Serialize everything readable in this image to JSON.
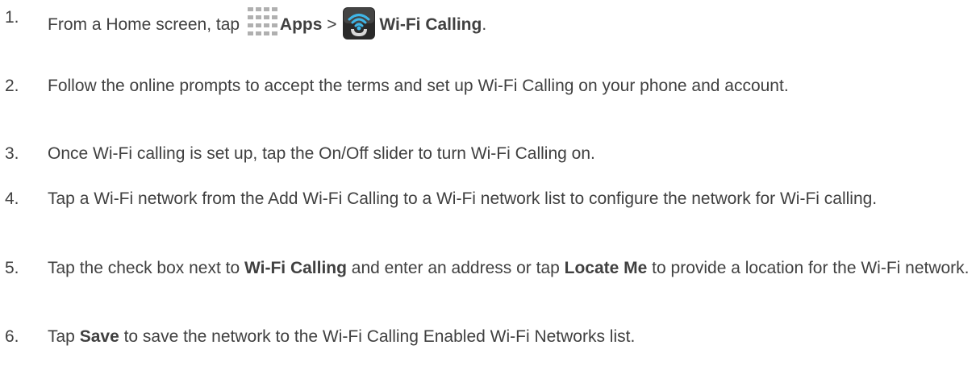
{
  "steps": [
    {
      "number": "1.",
      "pre": "From a Home screen, tap ",
      "apps_label": "Apps",
      "separator": " > ",
      "wifi_label": "Wi-Fi Calling",
      "post": "."
    },
    {
      "number": "2.",
      "text": "Follow the online prompts to accept the terms and  set up Wi-Fi Calling on your phone and account."
    },
    {
      "number": "3.",
      "text": "Once Wi-Fi calling is set up, tap the On/Off slider to turn Wi-Fi Calling on."
    },
    {
      "number": "4.",
      "text": "Tap a Wi-Fi network from the Add Wi-Fi Calling to a Wi-Fi network list to configure the network for Wi-Fi calling."
    },
    {
      "number": "5.",
      "pre": "Tap the check box next to ",
      "bold1": "Wi-Fi Calling",
      "mid": " and enter an address or tap ",
      "bold2": "Locate Me",
      "post": " to provide a location for the Wi-Fi network."
    },
    {
      "number": "6.",
      "pre": "Tap ",
      "bold1": "Save",
      "post": " to save the network to the Wi-Fi Calling Enabled Wi-Fi Networks list."
    }
  ],
  "icons": {
    "apps": "apps-grid-icon",
    "wifi_calling": "wifi-calling-icon"
  },
  "colors": {
    "text": "#404040",
    "apps_icon": "#b0b0b0",
    "wifi_icon_bg": "#2a2a2a",
    "wifi_icon_accent": "#3fb6e8"
  }
}
